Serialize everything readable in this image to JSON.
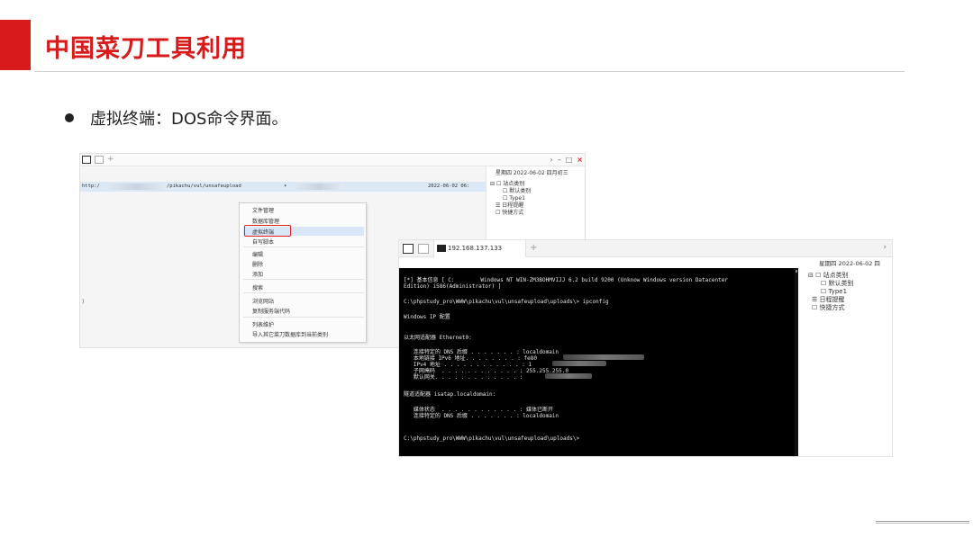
{
  "slide": {
    "title": "中国菜刀工具利用",
    "bullet": "虚拟终端：DOS命令界面。"
  },
  "shot1": {
    "plus": "+",
    "controls": {
      "chev": "›",
      "min": "–",
      "max": "□",
      "close": "×"
    },
    "row": {
      "url_a": "http:/",
      "url_b": "/pikachu/vul/unsafeupload",
      "date": "2022-06-02 06:",
      "arrow": "▾"
    },
    "sidebar": {
      "date": "星期四 2022-06-02 四月初三",
      "items": [
        "⊟ ☐ 站点类别",
        "☐ 默认类别",
        "☐ Type1",
        "☰ 日程提醒",
        "☐ 快捷方式"
      ]
    },
    "menu": [
      "文件管理",
      "数据库管理",
      "虚拟终端",
      "自写脚本",
      "编辑",
      "删除",
      "添加",
      "搜索",
      "浏览网站",
      "复制服务端代码",
      "列表维护",
      "导入其它菜刀数据库到当前类别"
    ],
    "left_mark": ")"
  },
  "shot2": {
    "tab_label": "192.168.137.133",
    "plus": "+",
    "chev": "›",
    "sidebar": {
      "date": "星期四 2022-06-02 四",
      "items": [
        "⊟ ☐ 站点类别",
        "☐ 默认类别",
        "☐ Type1",
        "☰ 日程提醒",
        "☐ 快捷方式"
      ]
    },
    "terminal": [
      "[*] 基本信息 [ C:        Windows NT WIN-ZM3BOHMVIJJ 6.2 build 9200 (Unknow Windows version Datacenter",
      "Edition) i586(Administrator) ]",
      "C:\\phpstudy_pro\\WWW\\pikachu\\vul\\unsafeupload\\uploads\\> ipconfig",
      "Windows IP 配置",
      "以太网适配器 Ethernet0:",
      "   连接特定的 DNS 后缀 . . . . . . . : localdomain",
      "   本地链接 IPv6 地址. . . . . . . . : fe80",
      "   IPv4 地址 . . . . . . . . . . . . : 1",
      "   子网掩码  . . . . . . . . . . . . : 255.255.255.0",
      "   默认网关. . . . . . . . . . . . . :",
      "隧道适配器 isatap.localdomain:",
      "   媒体状态  . . . . . . . . . . . . : 媒体已断开",
      "   连接特定的 DNS 后缀 . . . . . . . : localdomain",
      "C:\\phpstudy_pro\\WWW\\pikachu\\vul\\unsafeupload\\uploads\\>"
    ]
  }
}
